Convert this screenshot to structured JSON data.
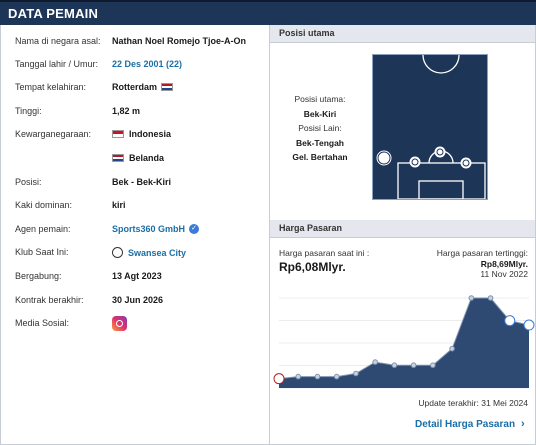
{
  "header": {
    "title": "DATA PEMAIN"
  },
  "player": [
    {
      "label": "Nama di negara asal:",
      "value": "Nathan Noel Romejo Tjoe-A-On"
    },
    {
      "label": "Tanggal lahir / Umur:",
      "value": "22 Des 2001 (22)"
    },
    {
      "label": "Tempat kelahiran:",
      "value": "Rotterdam"
    },
    {
      "label": "Tinggi:",
      "value": "1,82 m"
    },
    {
      "label": "Kewarganegaraan:",
      "value": "Indonesia"
    },
    {
      "label": "",
      "value": "Belanda"
    },
    {
      "label": "Posisi:",
      "value": "Bek - Bek-Kiri"
    },
    {
      "label": "Kaki dominan:",
      "value": "kiri"
    },
    {
      "label": "Agen pemain:",
      "value": "Sports360 GmbH"
    },
    {
      "label": "Klub Saat Ini:",
      "value": "Swansea City"
    },
    {
      "label": "Bergabung:",
      "value": "13 Agt 2023"
    },
    {
      "label": "Kontrak berakhir:",
      "value": "30 Jun 2026"
    },
    {
      "label": "Media Sosial:",
      "value": ""
    }
  ],
  "icons": {
    "birthplace_flag": "netherlands-flag-icon",
    "nationality_flags": [
      "indonesia-flag-icon",
      "netherlands-flag-icon"
    ],
    "agent_verified": "verified-check-icon",
    "club": "swansea-city-logo-icon",
    "social": "instagram-icon"
  },
  "position": {
    "section_title": "Posisi utama",
    "main_label": "Posisi utama:",
    "main_value": "Bek-Kiri",
    "other_label": "Posisi Lain:",
    "other_values": [
      "Bek-Tengah",
      "Gel. Bertahan"
    ]
  },
  "market_value": {
    "section_title": "Harga Pasaran",
    "current_label": "Harga pasaran saat ini :",
    "current_value": "Rp6,08Mlyr.",
    "highest_label": "Harga pasaran tertinggi:",
    "highest_value": "Rp8,69Mlyr.",
    "highest_date": "11 Nov 2022",
    "updated": "Update terakhir: 31 Mei 2024",
    "detail_link": "Detail Harga Pasaran"
  },
  "colors": {
    "header_bg": "#1d3557",
    "link": "#1a6fa8",
    "chart_fill": "#2e4a73",
    "pitch_bg": "#1d3557"
  },
  "chart_data": {
    "type": "area",
    "title": "",
    "xlabel": "",
    "ylabel": "",
    "grid": true,
    "series": [
      {
        "values": [
          0.9,
          1.1,
          1.1,
          1.1,
          1.4,
          2.5,
          2.2,
          2.2,
          2.2,
          3.8,
          8.69,
          8.69,
          6.5,
          6.08
        ]
      }
    ]
  }
}
